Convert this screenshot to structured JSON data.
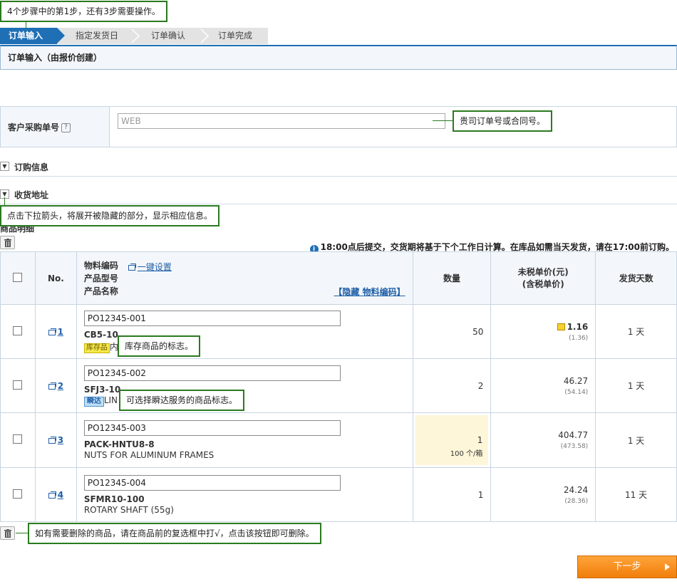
{
  "steps": [
    "订单输入",
    "指定发货日",
    "订单确认",
    "订单完成"
  ],
  "page_title": "订单输入（由报价创建）",
  "po_row": {
    "label": "客户采购单号",
    "help_icon": "?",
    "input_value": "WEB"
  },
  "sections": {
    "order_info": "订购信息",
    "shipping_address": "收货地址",
    "product_detail": "商品明细"
  },
  "notice": {
    "icon": "i",
    "text": "18:00点后提交，交货期将基于下个工作日计算。在库品如需当天发货，请在17:00前订购。"
  },
  "table": {
    "headers": {
      "no": "No.",
      "code_lines": [
        "物料编码",
        "产品型号",
        "产品名称"
      ],
      "bulk_set": "一键设置",
      "hide_code": "【隐藏 物料编码】",
      "qty": "数量",
      "price_lines": [
        "未税单价(元)",
        "(含税单价)"
      ],
      "ship_days": "发货天数"
    },
    "rows": [
      {
        "no": "1",
        "code": "PO12345-001",
        "model": "CB5-10",
        "badge": "库存品",
        "name": "内",
        "qty": "50",
        "unit": "",
        "price": "1.16",
        "tax_price": "(1.36)",
        "days": "1 天"
      },
      {
        "no": "2",
        "code": "PO12345-002",
        "model": "SFJ3-10",
        "badge": "瞬达",
        "name": "LIN",
        "qty": "2",
        "unit": "",
        "price": "46.27",
        "tax_price": "(54.14)",
        "days": "1 天"
      },
      {
        "no": "3",
        "code": "PO12345-003",
        "model": "PACK-HNTU8-8",
        "badge": "",
        "name": "NUTS FOR ALUMINUM FRAMES",
        "qty": "1",
        "unit": "100 个/箱",
        "price": "404.77",
        "tax_price": "(473.58)",
        "days": "1 天"
      },
      {
        "no": "4",
        "code": "PO12345-004",
        "model": "SFMR10-100",
        "badge": "",
        "name": "ROTARY SHAFT (55g)",
        "qty": "1",
        "unit": "",
        "price": "24.24",
        "tax_price": "(28.36)",
        "days": "11 天"
      }
    ]
  },
  "callouts": {
    "steps": "4个步骤中的第1步，还有3步需要操作。",
    "po": "贵司订单号或合同号。",
    "toggle": "点击下拉箭头，将展开被隐藏的部分，显示相应信息。",
    "stock": "库存商品的标志。",
    "express": "可选择瞬达服务的商品标志。",
    "delete": "如有需要删除的商品，请在商品前的复选框中打√，点击该按钮即可删除。"
  },
  "next_button": "下一步",
  "colors": {
    "step_active": "#1f6fb5",
    "callout_border": "#2a7a1f",
    "next_button": "#f58f1f",
    "qty_highlight": "#fdf6d8"
  }
}
